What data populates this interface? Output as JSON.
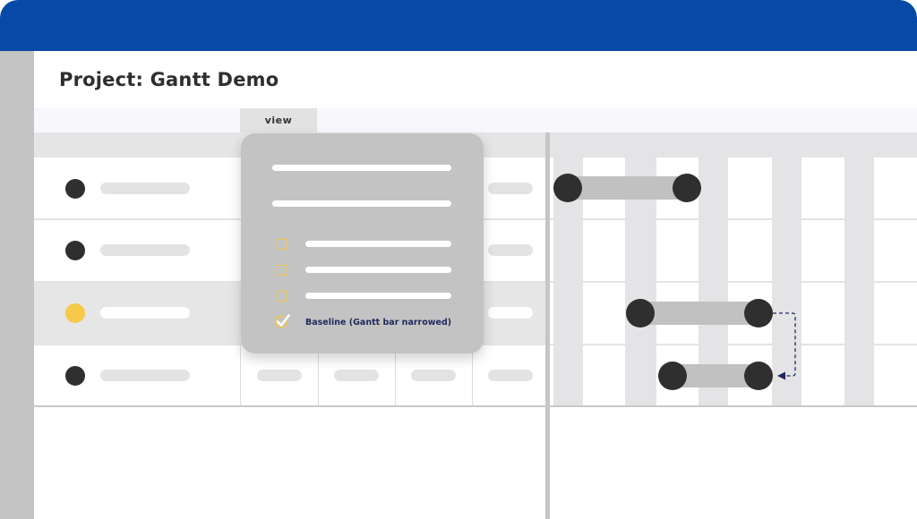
{
  "colors": {
    "topbar": "#0749A7",
    "accent_yellow": "#F7C948",
    "checkbox": "#F2C94C",
    "dependency_arrow": "#1F2A5C",
    "dot_dark": "#2F2F2F"
  },
  "project": {
    "title": "Project: Gantt Demo"
  },
  "toolbar": {
    "view_tab": "view"
  },
  "rows": [
    {
      "status": "default",
      "selected": false
    },
    {
      "status": "default",
      "selected": false
    },
    {
      "status": "highlighted",
      "selected": true
    },
    {
      "status": "default",
      "selected": false
    }
  ],
  "view_menu": {
    "options": [
      {
        "checked": false,
        "label": ""
      },
      {
        "checked": false,
        "label": ""
      },
      {
        "checked": false,
        "label": ""
      },
      {
        "checked": true,
        "label": "Baseline (Gantt bar narrowed)"
      }
    ]
  },
  "gantt": {
    "dependency": {
      "from_task": 3,
      "to_task": 4
    }
  }
}
